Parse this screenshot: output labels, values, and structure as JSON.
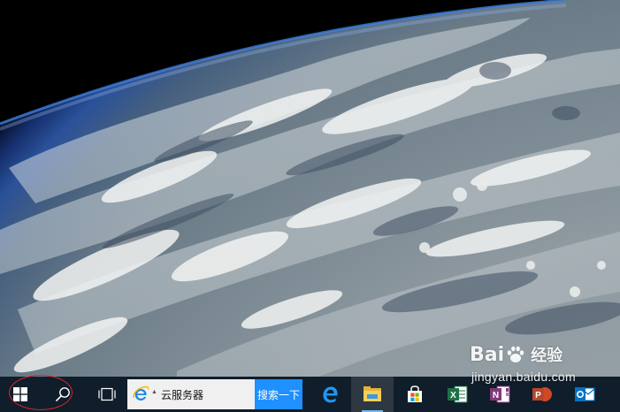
{
  "wallpaper": {
    "description_icon": "earth-from-orbit"
  },
  "taskbar": {
    "background": "#101d2a",
    "start_icon": "windows-logo-icon",
    "search_icon": "magnifier-icon",
    "taskview_icon": "task-view-icon",
    "search_box": {
      "browser_icon": "internet-explorer-icon",
      "query": "云服务器",
      "go_label": "搜索一下",
      "go_color": "#1e90ff"
    },
    "pinned_apps": [
      {
        "name": "edge-icon"
      },
      {
        "name": "file-explorer-icon"
      },
      {
        "name": "store-icon"
      },
      {
        "name": "excel-icon"
      },
      {
        "name": "onenote-icon"
      },
      {
        "name": "powerpoint-icon"
      },
      {
        "name": "outlook-icon"
      }
    ]
  },
  "annotation": {
    "color": "#d8262e"
  },
  "watermark": {
    "brand_left": "Bai",
    "brand_right": "经验",
    "url": "jingyan.baidu.com"
  }
}
